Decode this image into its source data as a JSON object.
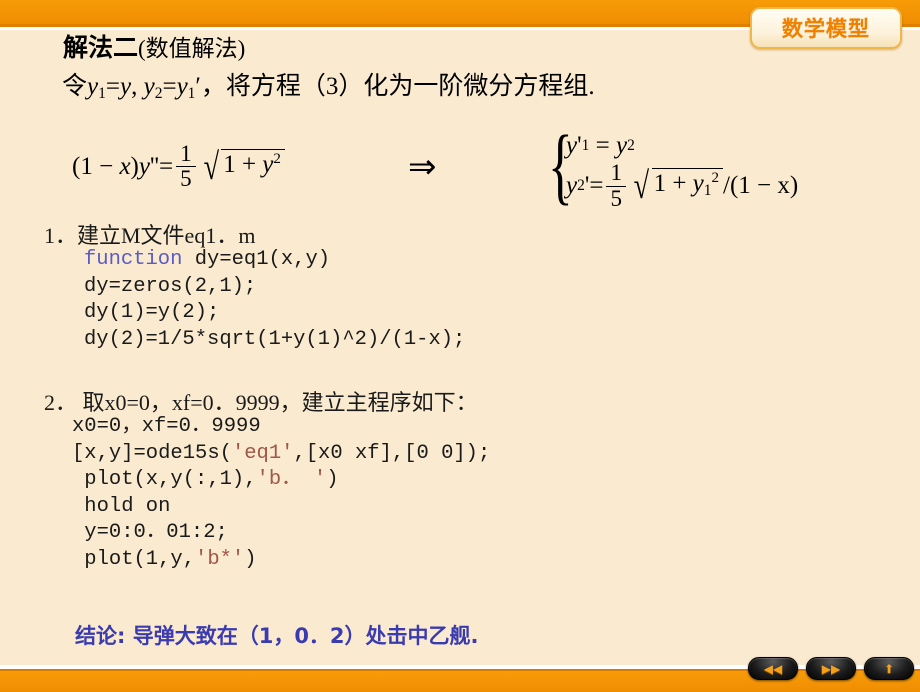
{
  "brand": {
    "badge_label": "数学模型"
  },
  "heading": {
    "title_strong": "解法二",
    "title_paren": "(数值解法)",
    "subtitle_prefix": "令",
    "subtitle_rest": "，将方程（3）化为一阶微分方程组."
  },
  "equation": {
    "left_lhs": "(1 − x) y'' =",
    "left_frac_num": "1",
    "left_frac_den": "5",
    "left_radicand": "1 + y",
    "implies_arrow": "⇒",
    "brace_glyph": "{",
    "system_row1": "y'₁ = y₂",
    "system_row2_lhs": "y₂' =",
    "system_row2_frac_num": "1",
    "system_row2_frac_den": "5",
    "system_row2_radicand": "1 + y",
    "system_row2_tail": "/(1 − x)"
  },
  "steps": [
    {
      "label": "1．建立M文件eq1．m",
      "code_lines": [
        {
          "segments": [
            {
              "text": "function",
              "style": "kw"
            },
            {
              "text": " dy=eq1(x,y)",
              "style": "plain"
            }
          ]
        },
        {
          "segments": [
            {
              "text": "dy=zeros(2,1);",
              "style": "plain"
            }
          ]
        },
        {
          "segments": [
            {
              "text": "dy(1)=y(2);",
              "style": "plain"
            }
          ]
        },
        {
          "segments": [
            {
              "text": "dy(2)=1/5*sqrt(1+y(1)^2)/(1-x);",
              "style": "plain"
            }
          ]
        }
      ]
    },
    {
      "label": "2． 取x0=0，xf=0．9999，建立主程序如下：",
      "code_lines": [
        {
          "segments": [
            {
              "text": "x0=0，xf=0．9999",
              "style": "plain"
            }
          ]
        },
        {
          "segments": [
            {
              "text": "[x,y]=ode15s(",
              "style": "plain"
            },
            {
              "text": "'eq1'",
              "style": "str"
            },
            {
              "text": ",[x0 xf],[0 0]);",
              "style": "plain"
            }
          ]
        },
        {
          "segments": [
            {
              "text": " plot(x,y(:,1),",
              "style": "plain"
            },
            {
              "text": "'b． '",
              "style": "str"
            },
            {
              "text": ")",
              "style": "plain"
            }
          ]
        },
        {
          "segments": [
            {
              "text": " hold on",
              "style": "plain"
            }
          ]
        },
        {
          "segments": [
            {
              "text": " y=0:0．01:2;",
              "style": "plain"
            }
          ]
        },
        {
          "segments": [
            {
              "text": " plot(1,y,",
              "style": "plain"
            },
            {
              "text": "'b*'",
              "style": "str"
            },
            {
              "text": ")",
              "style": "plain"
            }
          ]
        }
      ]
    }
  ],
  "conclusion": {
    "text": "结论: 导弹大致在（1，0．2）处击中乙舰."
  },
  "nav": {
    "buttons": [
      {
        "name": "previous",
        "glyph": "◀◀"
      },
      {
        "name": "next",
        "glyph": "▶▶"
      },
      {
        "name": "return",
        "glyph": "⬆"
      }
    ]
  },
  "colors": {
    "band_orange": "#f59505",
    "background_cream": "#faebd0",
    "keyword_blue": "#5b5bc4",
    "string_brown": "#a0564a",
    "conclusion_blue": "#3b3bb0",
    "badge_orange": "#f08000"
  }
}
